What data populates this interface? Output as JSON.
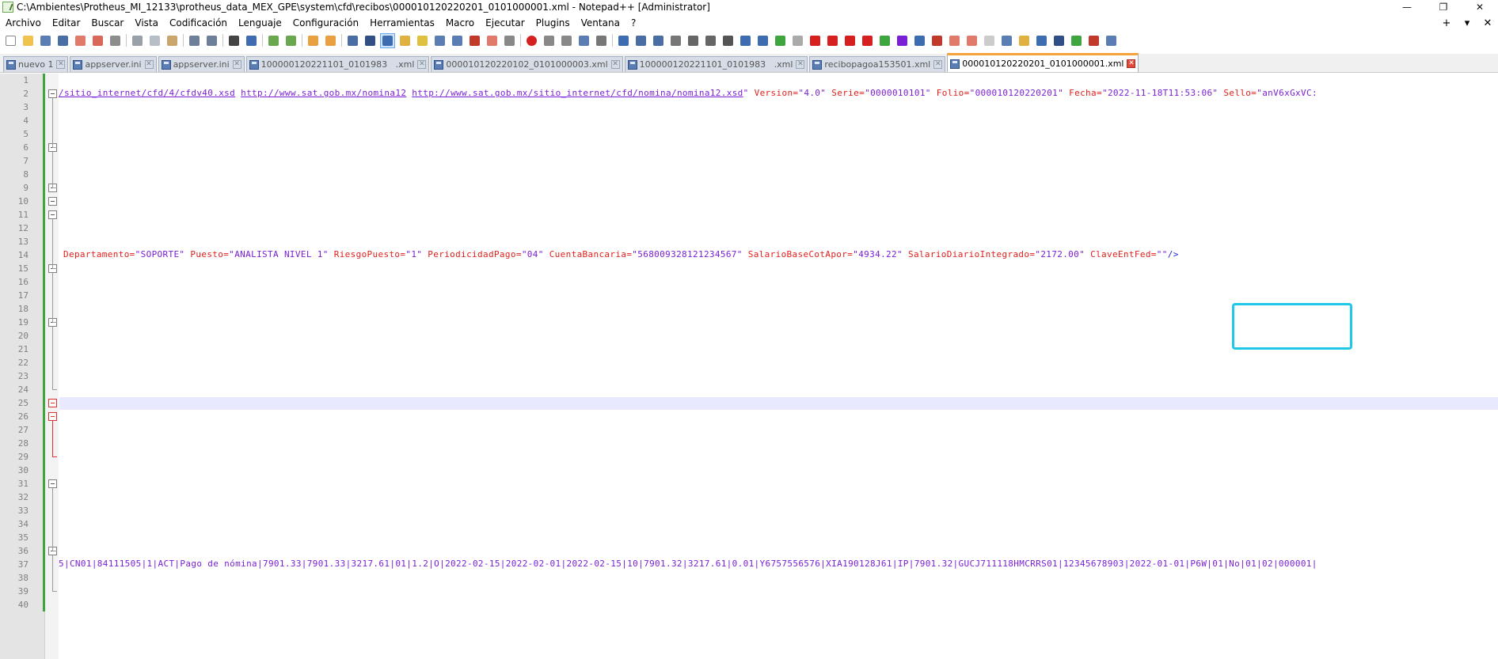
{
  "window": {
    "title": "C:\\Ambientes\\Protheus_MI_12133\\protheus_data_MEX_GPE\\system\\cfd\\recibos\\000010120220201_0101000001.xml - Notepad++ [Administrator]",
    "controls": [
      "—",
      "❐",
      "✕"
    ]
  },
  "menu": {
    "items": [
      "Archivo",
      "Editar",
      "Buscar",
      "Vista",
      "Codificación",
      "Lenguaje",
      "Configuración",
      "Herramientas",
      "Macro",
      "Ejecutar",
      "Plugins",
      "Ventana",
      "?"
    ],
    "right": [
      "+",
      "▾",
      "✕"
    ]
  },
  "tabs": [
    {
      "label": "nuevo 1",
      "active": false
    },
    {
      "label": "appserver.ini",
      "active": false
    },
    {
      "label": "appserver.ini",
      "active": false
    },
    {
      "label": "100000120221101_0101983   .xml",
      "active": false
    },
    {
      "label": "000010120220102_0101000003.xml",
      "active": false
    },
    {
      "label": "100000120221101_0101983   .xml",
      "active": false
    },
    {
      "label": "recibopagoa153501.xml",
      "active": false
    },
    {
      "label": "000010120220201_0101000001.xml",
      "active": true
    }
  ],
  "editor": {
    "line_numbers": [
      "1",
      "2",
      "3",
      "4",
      "5",
      "6",
      "7",
      "8",
      "9",
      "10",
      "11",
      "12",
      "13",
      "14",
      "15",
      "16",
      "17",
      "18",
      "19",
      "20",
      "21",
      "22",
      "23",
      "24",
      "25",
      "26",
      "27",
      "28",
      "29",
      "30",
      "31",
      "32",
      "33",
      "34",
      "35",
      "36",
      "37",
      "38",
      "39",
      "40"
    ],
    "line2": {
      "link1": "/sitio_internet/cfd/4/cfdv40.xsd",
      "link2": "http://www.sat.gob.mx/nomina12",
      "link3": "http://www.sat.gob.mx/sitio_internet/cfd/nomina/nomina12.xsd",
      "q1": "\"",
      "attr1": "Version=",
      "val1": "\"4.0\"",
      "attr2": "Serie=",
      "val2": "\"0000010101\"",
      "attr3": "Folio=",
      "val3": "\"000010120220201\"",
      "attr4": "Fecha=",
      "val4": "\"2022-11-18T11:53:06\"",
      "attr5": "Sello=",
      "val5": "\"anV6xGxVC:"
    },
    "line14": {
      "attr1": "Departamento=",
      "val1": "\"SOPORTE\"",
      "attr2": "Puesto=",
      "val2": "\"ANALISTA NIVEL 1\"",
      "attr3": "RiesgoPuesto=",
      "val3": "\"1\"",
      "attr4": "PeriodicidadPago=",
      "val4": "\"04\"",
      "attr5": "CuentaBancaria=",
      "val5": "\"568009328121234567\"",
      "attr6": "SalarioBaseCotApor=",
      "val6": "\"4934.22\"",
      "attr7": "SalarioDiarioIntegrado=",
      "val7": "\"2172.00\"",
      "attr8": "ClaveEntFed=",
      "val8": "\"\"",
      "tag_end": "/>"
    },
    "line37": "5|CN01|84111505|1|ACT|Pago de nómina|7901.33|7901.33|3217.61|01|1.2|O|2022-02-15|2022-02-01|2022-02-15|10|7901.32|3217.61|0.01|Y6757556576|XIA190128J61|IP|7901.32|GUCJ711118HMCRRS01|12345678903|2022-01-01|P6W|01|No|01|02|000001|"
  },
  "colors": {
    "highlight_box": "#1ec8e6",
    "attribute": "#e0201c",
    "value": "#7a1fd6",
    "current_line": "#e8e8ff",
    "active_tab_accent": "#f7a33b"
  }
}
